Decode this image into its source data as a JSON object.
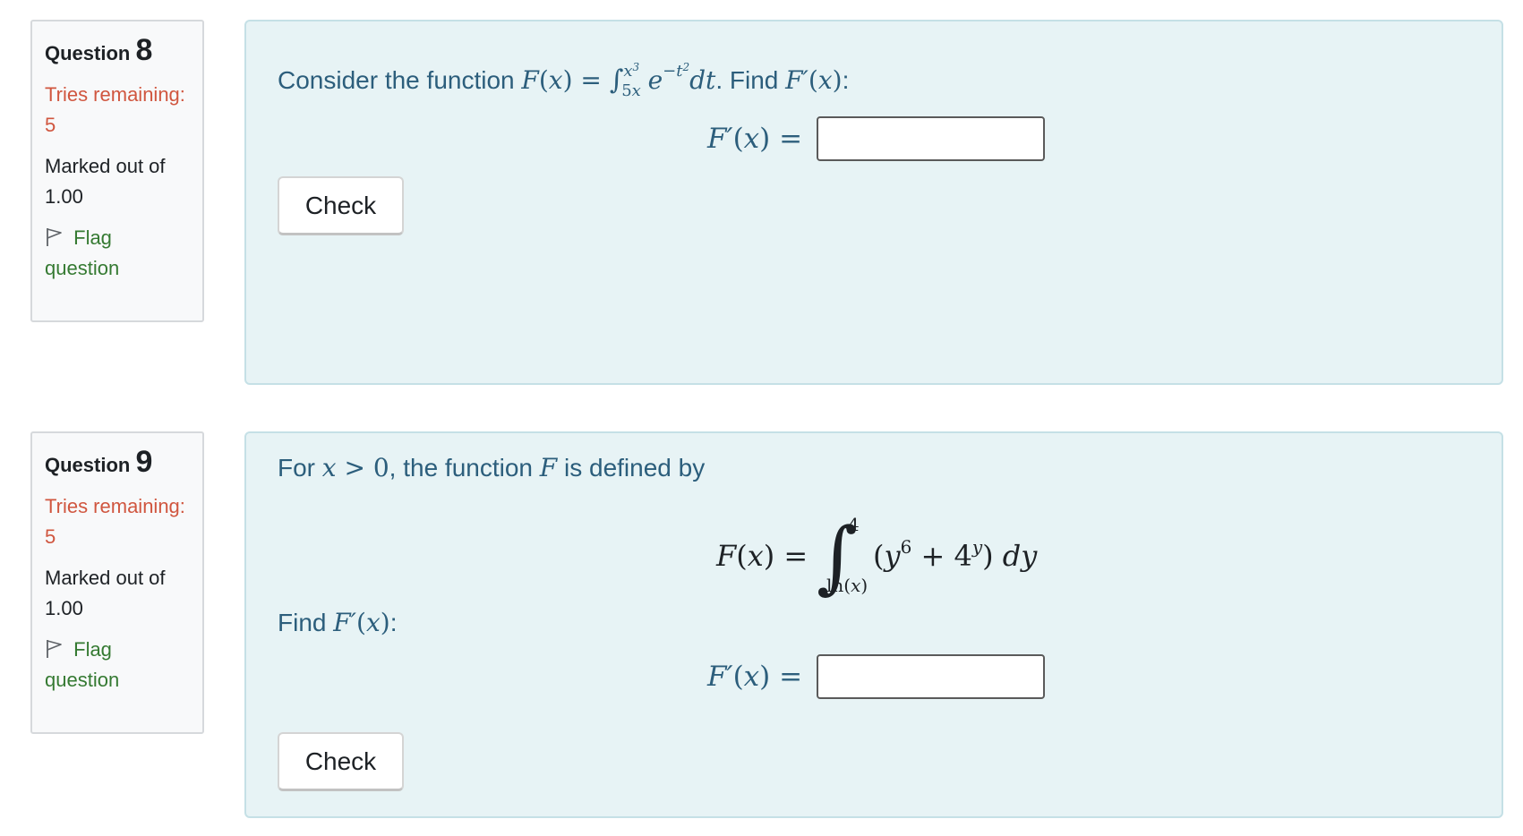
{
  "questions": [
    {
      "label": "Question",
      "number": "8",
      "tries": "Tries remaining: 5",
      "marked": "Marked out of 1.00",
      "flag": "Flag question",
      "text_prefix": "Consider the function",
      "text_find": ". Find",
      "answer_label": "F′(x) =",
      "answer_value": "",
      "check_label": "Check"
    },
    {
      "label": "Question",
      "number": "9",
      "tries": "Tries remaining: 5",
      "marked": "Marked out of 1.00",
      "flag": "Flag question",
      "text_prefix": "For",
      "text_mid": ", the function",
      "text_suffix": "is defined by",
      "find_text": "Find",
      "answer_label": "F′(x) =",
      "answer_value": "",
      "check_label": "Check"
    }
  ],
  "colors": {
    "tries": "#d0563f",
    "flag": "#357a32",
    "question_text": "#2c5e7c",
    "content_bg": "#e7f3f5",
    "info_bg": "#f8f9fa"
  },
  "icons": {
    "flag": "flag-outline-icon"
  }
}
